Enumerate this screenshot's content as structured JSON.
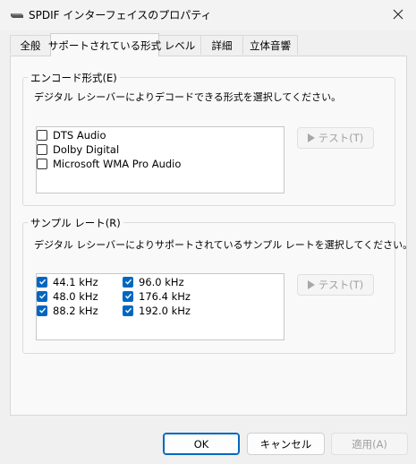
{
  "window": {
    "title": "SPDIF インターフェイスのプロパティ",
    "close_glyph": "✕"
  },
  "tabs": [
    {
      "label": "全般"
    },
    {
      "label": "サポートされている形式",
      "selected": true
    },
    {
      "label": "レベル"
    },
    {
      "label": "詳細"
    },
    {
      "label": "立体音響"
    }
  ],
  "encoding": {
    "legend": "エンコード形式(E)",
    "description": "デジタル レシーバーによりデコードできる形式を選択してください。",
    "formats": [
      {
        "label": "DTS Audio",
        "checked": false
      },
      {
        "label": "Dolby Digital",
        "checked": false
      },
      {
        "label": "Microsoft WMA Pro Audio",
        "checked": false
      }
    ],
    "test_button": "テスト(T)"
  },
  "sample_rate": {
    "legend": "サンプル レート(R)",
    "description": "デジタル レシーバーによりサポートされているサンプル レートを選択してください。",
    "rates": [
      {
        "label": "44.1 kHz",
        "checked": true
      },
      {
        "label": "48.0 kHz",
        "checked": true
      },
      {
        "label": "88.2 kHz",
        "checked": true
      },
      {
        "label": "96.0 kHz",
        "checked": true
      },
      {
        "label": "176.4 kHz",
        "checked": true
      },
      {
        "label": "192.0 kHz",
        "checked": true
      }
    ],
    "test_button": "テスト(T)"
  },
  "footer": {
    "ok": "OK",
    "cancel": "キャンセル",
    "apply": "適用(A)"
  },
  "colors": {
    "accent": "#0067c0",
    "disabled_text": "#a0a0a0"
  }
}
